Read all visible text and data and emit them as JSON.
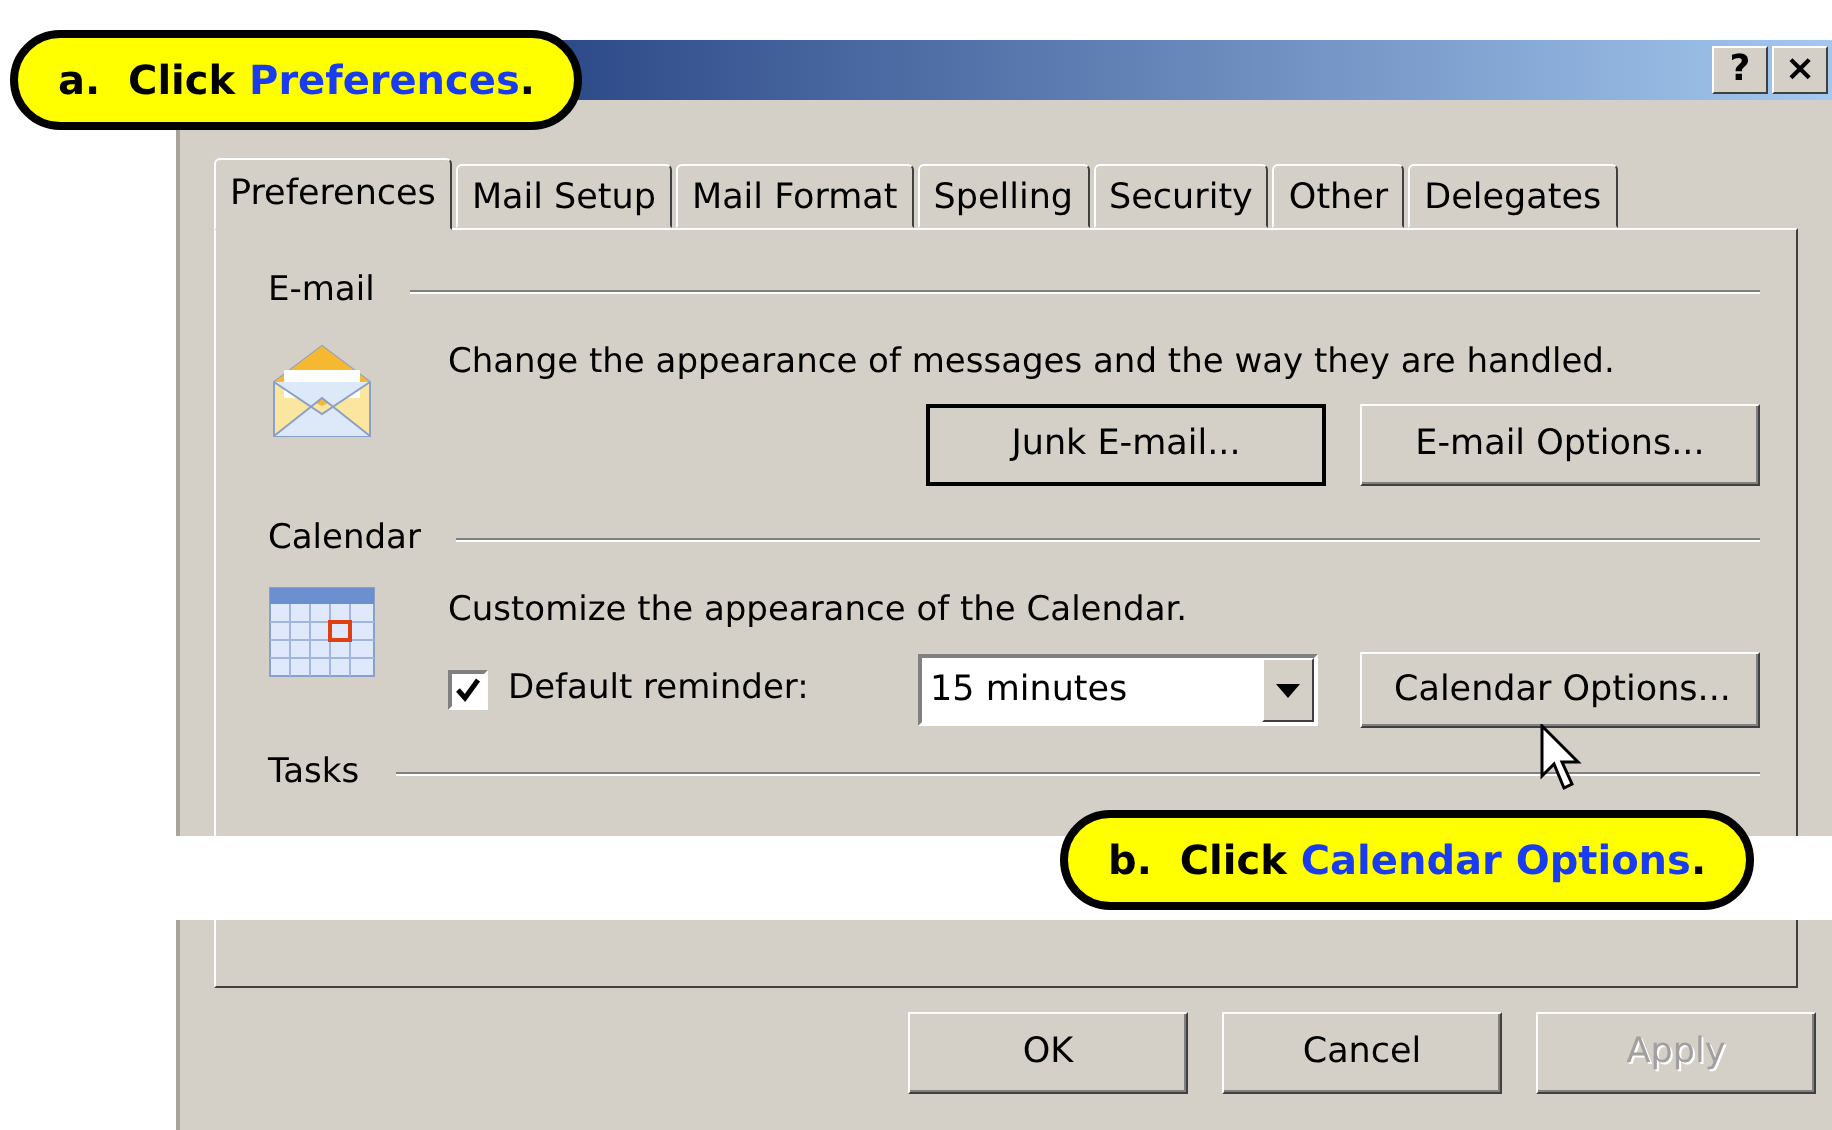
{
  "window": {
    "help_button": "?",
    "close_button": "×"
  },
  "callouts": [
    {
      "step": "a.",
      "action": "Click",
      "target": "Preferences",
      "end": "."
    },
    {
      "step": "b.",
      "action": "Click",
      "target": "Calendar Options",
      "end": "."
    }
  ],
  "tabs": [
    {
      "label": "Preferences",
      "selected": true
    },
    {
      "label": "Mail Setup",
      "selected": false
    },
    {
      "label": "Mail Format",
      "selected": false
    },
    {
      "label": "Spelling",
      "selected": false
    },
    {
      "label": "Security",
      "selected": false
    },
    {
      "label": "Other",
      "selected": false
    },
    {
      "label": "Delegates",
      "selected": false
    }
  ],
  "email": {
    "heading": "E-mail",
    "description": "Change the appearance of messages and the way they are handled.",
    "buttons": [
      {
        "label": "Junk E-mail...",
        "default": true
      },
      {
        "label": "E-mail Options...",
        "default": false
      }
    ]
  },
  "calendar": {
    "heading": "Calendar",
    "description": "Customize the appearance of the Calendar.",
    "reminder": {
      "label": "Default reminder:",
      "checked": true,
      "value": "15 minutes"
    },
    "button": "Calendar Options..."
  },
  "tasks": {
    "heading": "Tasks"
  },
  "footer_buttons": [
    {
      "label": "OK",
      "disabled": false
    },
    {
      "label": "Cancel",
      "disabled": false
    },
    {
      "label": "Apply",
      "disabled": true
    }
  ]
}
